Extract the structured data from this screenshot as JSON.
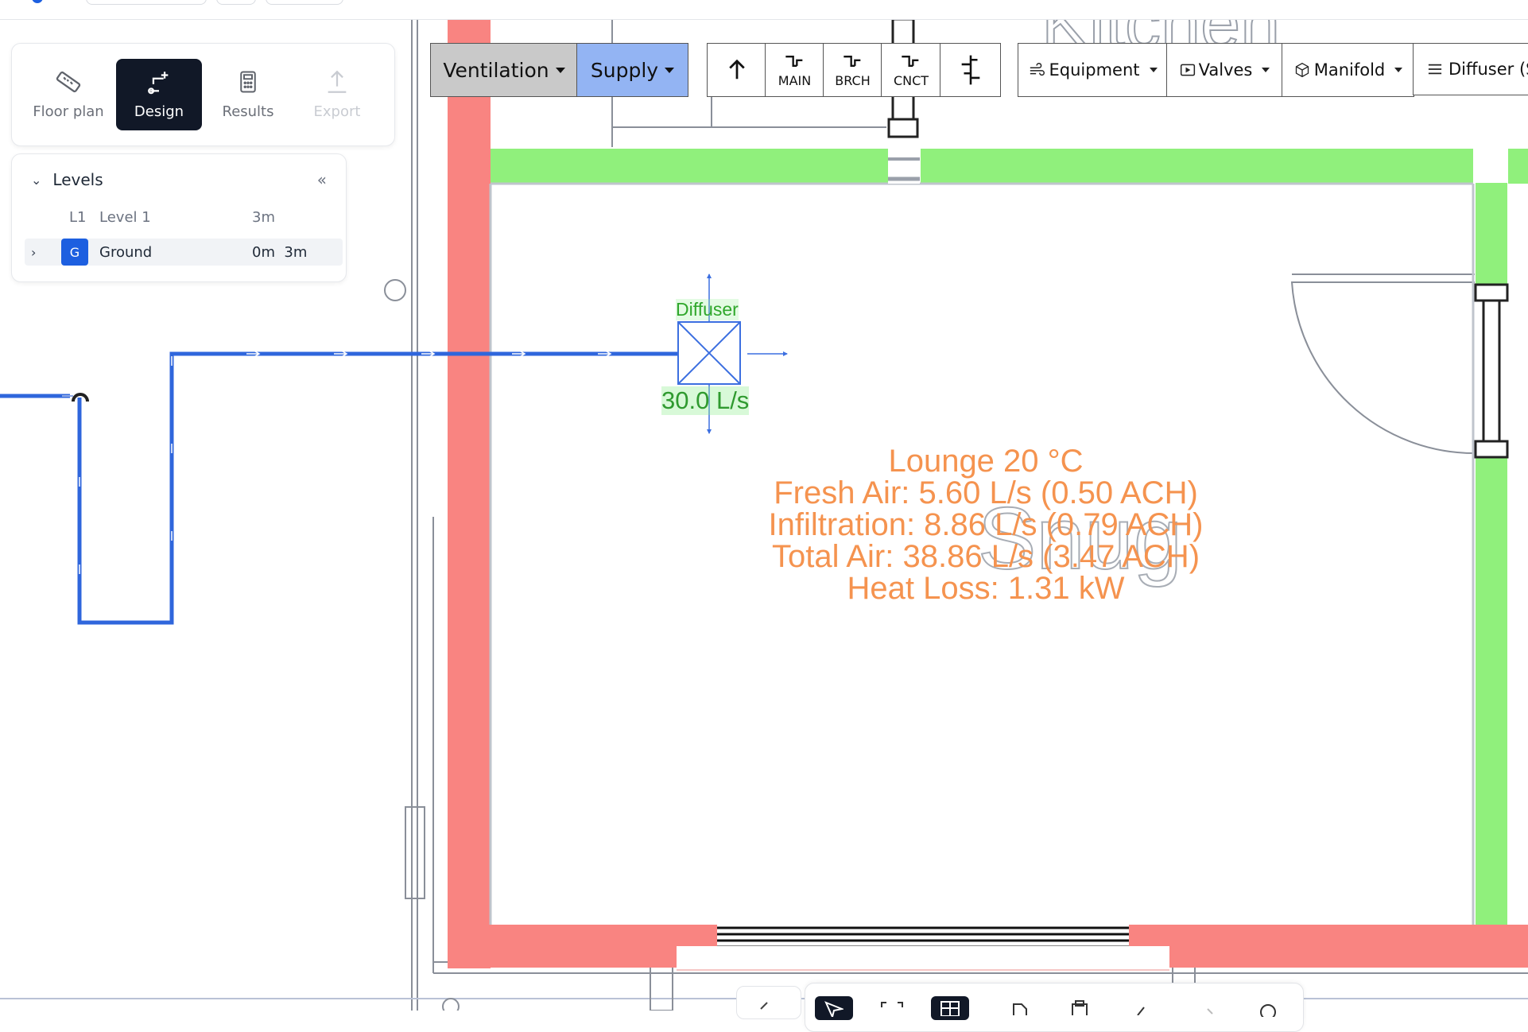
{
  "mode_tabs": [
    {
      "label": "Floor plan",
      "icon": "ruler-icon",
      "state": "normal"
    },
    {
      "label": "Design",
      "icon": "design-pipe-icon",
      "state": "active"
    },
    {
      "label": "Results",
      "icon": "calculator-icon",
      "state": "normal"
    },
    {
      "label": "Export",
      "icon": "export-icon",
      "state": "disabled"
    }
  ],
  "levels": {
    "title": "Levels",
    "rows": [
      {
        "code": "L1",
        "name": "Level 1",
        "height": "3m",
        "active": false
      },
      {
        "code": "G",
        "name": "Ground",
        "height": "0m  3m",
        "active": true
      }
    ]
  },
  "toolbar": {
    "system": "Ventilation",
    "flow": "Supply",
    "pipe_buttons": [
      {
        "label": "",
        "icon": "arrow-up-icon"
      },
      {
        "label": "MAIN",
        "icon": "main-pipe-icon"
      },
      {
        "label": "BRCH",
        "icon": "branch-pipe-icon"
      },
      {
        "label": "CNCT",
        "icon": "connect-pipe-icon"
      },
      {
        "label": "",
        "icon": "riser-icon"
      }
    ],
    "dropdowns": [
      {
        "label": "Equipment",
        "icon": "airflow-icon"
      },
      {
        "label": "Valves",
        "icon": "valve-icon"
      },
      {
        "label": "Manifold",
        "icon": "box-icon"
      },
      {
        "label": "Diffuser (S",
        "icon": "menu-icon"
      }
    ]
  },
  "canvas": {
    "background_room_label": "Kitchen",
    "room_name_watermark": "Snug",
    "diffuser": {
      "label": "Diffuser",
      "flow": "30.0 L/s"
    },
    "room_info": [
      "Lounge 20 °C",
      "Fresh Air: 5.60 L/s (0.50  ACH)",
      "Infiltration: 8.86 L/s (0.79  ACH)",
      "Total Air: 38.86 L/s (3.47  ACH)",
      "Heat Loss: 1.31 kW"
    ]
  },
  "colors": {
    "wall_external": "#f98481",
    "wall_internal": "#90f07c",
    "duct": "#2f66dc",
    "diffuser": "#3c6fe0",
    "room_text": "#f5934f",
    "accent": "#1d5fe0",
    "toolbar_system_bg": "#c9c9c9",
    "toolbar_flow_bg": "#93b4f3"
  }
}
